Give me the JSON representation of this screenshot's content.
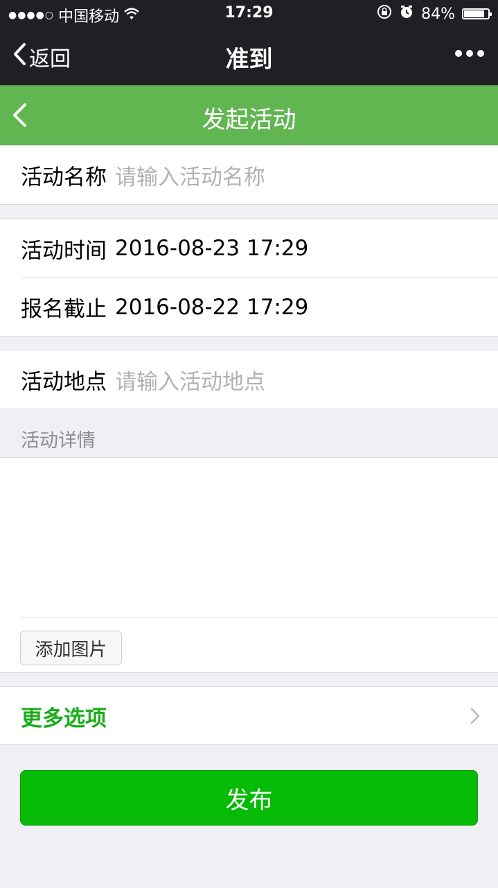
{
  "status_bar": {
    "signal": "●●●●○",
    "carrier": "中国移动",
    "time": "17:29",
    "battery_text": "84%",
    "battery_level": 0.84
  },
  "nav": {
    "back_label": "返回",
    "title": "准到"
  },
  "header": {
    "title": "发起活动"
  },
  "form": {
    "name_label": "活动名称",
    "name_placeholder": "请输入活动名称",
    "time_label": "活动时间",
    "time_value": "2016-08-23 17:29",
    "deadline_label": "报名截止",
    "deadline_value": "2016-08-22 17:29",
    "location_label": "活动地点",
    "location_placeholder": "请输入活动地点",
    "details_label": "活动详情",
    "add_image_label": "添加图片",
    "more_options_label": "更多选项",
    "publish_label": "发布"
  },
  "colors": {
    "nav_bg": "#1f1f24",
    "header_green": "#62b651",
    "accent_green": "#1aad19",
    "publish_green": "#05bb05"
  }
}
